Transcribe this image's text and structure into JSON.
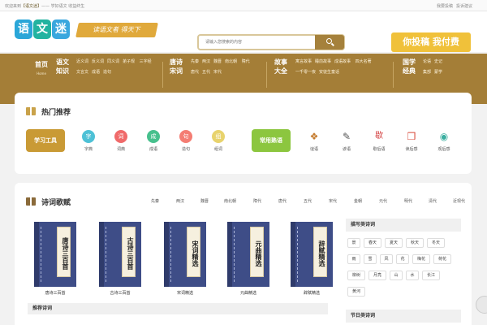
{
  "topbar": {
    "welcome_prefix": "欢迎来到",
    "site_name": "【语文迷】",
    "welcome_suffix": "—— 学好语文 收益终生",
    "links": [
      "我要投稿",
      "投诉建议"
    ]
  },
  "header": {
    "logo_chars": [
      "语",
      "文",
      "迷"
    ],
    "slogan": "读语文者 得天下",
    "search_placeholder": "请输入您搜索的内容",
    "contrib_banner": "你投稿 我付费"
  },
  "nav": {
    "groups": [
      {
        "head": "首页",
        "sub": "Home",
        "items": []
      },
      {
        "head": "语文知识",
        "sub": "",
        "items": [
          "近义词",
          "反义词",
          "同义词",
          "造句",
          "三字经",
          "文言文",
          "成语",
          "弟子规"
        ]
      },
      {
        "head": "唐诗宋词",
        "sub": "",
        "items": [
          "先秦",
          "两汉",
          "魏晋",
          "南北朝",
          "隋代",
          "唐代",
          "五代",
          "宋代"
        ]
      },
      {
        "head": "故事大全",
        "sub": "",
        "items": [
          "寓言故事",
          "睡前故事",
          "成语故事",
          "四大名著",
          "一千零一夜",
          "安徒生童话"
        ]
      },
      {
        "head": "国学经典",
        "sub": "",
        "items": [
          "论语",
          "史记",
          "集部",
          "蒙学"
        ]
      }
    ]
  },
  "hot": {
    "title": "热门推荐",
    "study_tools_label": "学习工具",
    "common_label": "常用熟语",
    "tools": [
      {
        "label": "字典",
        "icon": "dictionary-icon",
        "color": "#4ec1d6",
        "glyph": "字"
      },
      {
        "label": "词典",
        "icon": "word-dictionary-icon",
        "color": "#f06a6a",
        "glyph": "词"
      },
      {
        "label": "成语",
        "icon": "idiom-icon",
        "color": "#47c08d",
        "glyph": "成"
      },
      {
        "label": "造句",
        "icon": "sentence-icon",
        "color": "#f47d73",
        "glyph": "句"
      },
      {
        "label": "组词",
        "icon": "compose-words-icon",
        "color": "#e8d36d",
        "glyph": "组"
      }
    ],
    "common": [
      {
        "label": "谜语",
        "icon": "riddle-icon",
        "color": "#c47a2c",
        "glyph": "❖"
      },
      {
        "label": "谚语",
        "icon": "proverb-icon",
        "color": "#555555",
        "glyph": "✎"
      },
      {
        "label": "歇后语",
        "icon": "xiehouyu-icon",
        "color": "#d23b3b",
        "glyph": "歇"
      },
      {
        "label": "读后感",
        "icon": "reading-notes-icon",
        "color": "#d84a3a",
        "glyph": "❒"
      },
      {
        "label": "观后感",
        "icon": "eye-icon",
        "color": "#3aaea0",
        "glyph": "◉"
      }
    ]
  },
  "poetry": {
    "title": "诗词歌赋",
    "tabs": [
      "先秦",
      "两汉",
      "魏晋",
      "南北朝",
      "隋代",
      "唐代",
      "五代",
      "宋代",
      "金朝",
      "元代",
      "明代",
      "清代",
      "近现代"
    ],
    "books": [
      {
        "cover": "唐诗三百首",
        "caption": "唐诗三百首"
      },
      {
        "cover": "古诗三百首",
        "caption": "古诗三百首"
      },
      {
        "cover": "宋词精选",
        "caption": "宋词精选"
      },
      {
        "cover": "元曲精选",
        "caption": "元曲精选"
      },
      {
        "cover": "辞赋精选",
        "caption": "辞赋精选"
      }
    ],
    "recommend_title": "推荐诗词",
    "scenery_title": "描写类诗词",
    "scenery_keywords": [
      "景",
      "春天",
      "夏天",
      "秋天",
      "冬天",
      "雨",
      "雪",
      "风",
      "花",
      "梅花",
      "荷花",
      "柳树",
      "月亮",
      "山",
      "水",
      "长江",
      "黄河"
    ],
    "festival_title": "节日类诗词"
  }
}
